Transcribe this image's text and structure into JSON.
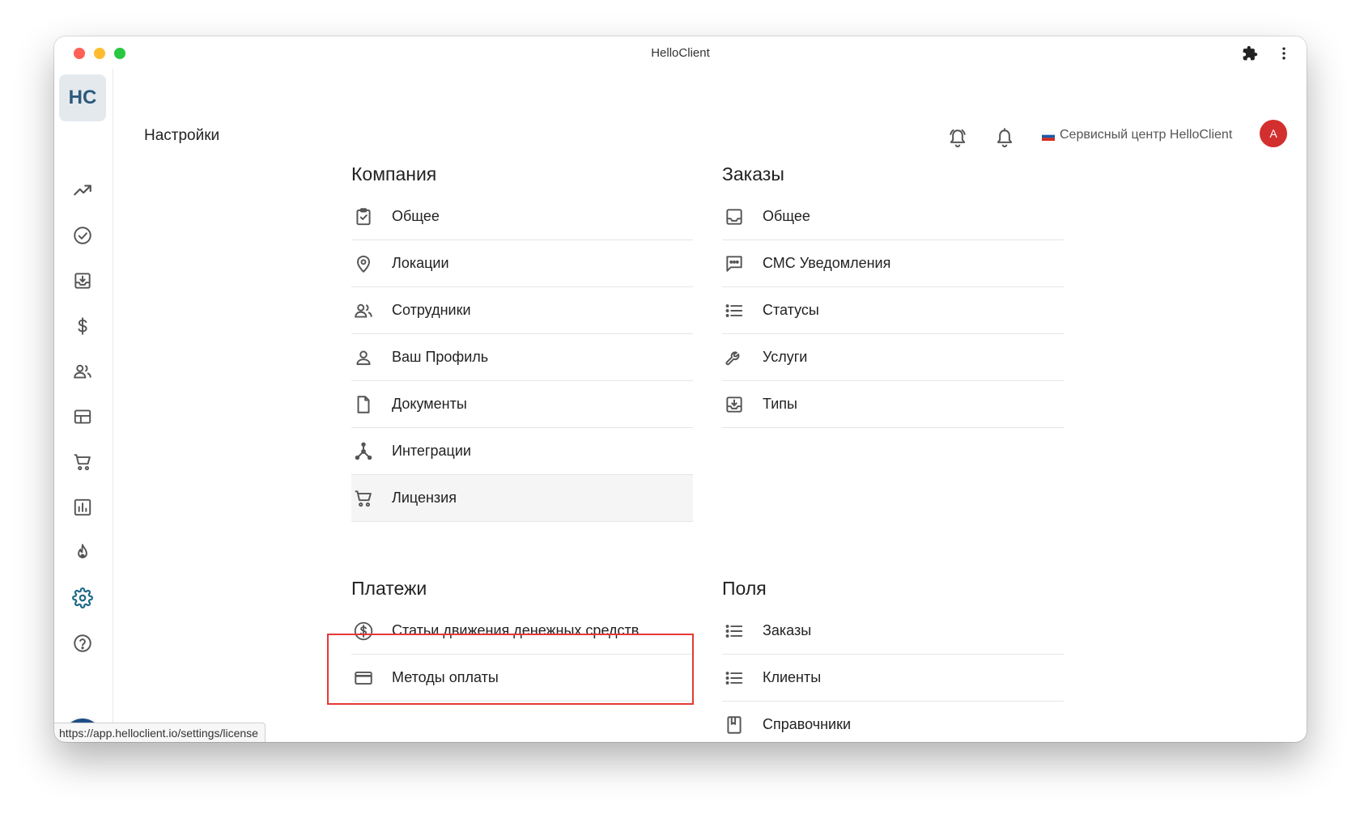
{
  "window": {
    "title": "HelloClient"
  },
  "sidebar": {
    "logo": "HC",
    "items": [
      {
        "name": "trending-up-icon"
      },
      {
        "name": "check-circle-icon"
      },
      {
        "name": "inbox-download-icon"
      },
      {
        "name": "dollar-icon"
      },
      {
        "name": "people-icon"
      },
      {
        "name": "table-icon"
      },
      {
        "name": "cart-icon"
      },
      {
        "name": "bar-chart-icon"
      },
      {
        "name": "fire-icon"
      },
      {
        "name": "settings-gear-icon",
        "active": true
      },
      {
        "name": "help-circle-icon"
      }
    ]
  },
  "header": {
    "title": "Настройки",
    "company": "Сервисный центр HelloClient",
    "avatar_initial": "A"
  },
  "sections": {
    "company": {
      "title": "Компания",
      "items": [
        {
          "label": "Общее",
          "icon": "clipboard-check-icon"
        },
        {
          "label": "Локации",
          "icon": "location-pin-icon"
        },
        {
          "label": "Сотрудники",
          "icon": "people-icon"
        },
        {
          "label": "Ваш Профиль",
          "icon": "person-icon"
        },
        {
          "label": "Документы",
          "icon": "document-icon"
        },
        {
          "label": "Интеграции",
          "icon": "hub-icon"
        },
        {
          "label": "Лицензия",
          "icon": "cart-icon",
          "active": true
        }
      ]
    },
    "orders": {
      "title": "Заказы",
      "items": [
        {
          "label": "Общее",
          "icon": "inbox-icon"
        },
        {
          "label": "СМС Уведомления",
          "icon": "sms-icon"
        },
        {
          "label": "Статусы",
          "icon": "list-icon"
        },
        {
          "label": "Услуги",
          "icon": "wrench-icon"
        },
        {
          "label": "Типы",
          "icon": "inbox-download-icon"
        }
      ]
    },
    "payments": {
      "title": "Платежи",
      "items": [
        {
          "label": "Статьи движения денежных средств",
          "icon": "dollar-circle-icon"
        },
        {
          "label": "Методы оплаты",
          "icon": "credit-card-icon"
        }
      ]
    },
    "fields": {
      "title": "Поля",
      "items": [
        {
          "label": "Заказы",
          "icon": "list-icon"
        },
        {
          "label": "Клиенты",
          "icon": "list-icon"
        },
        {
          "label": "Справочники",
          "icon": "book-icon"
        }
      ]
    }
  },
  "status_bar": {
    "url": "https://app.helloclient.io/settings/license"
  },
  "colors": {
    "accent": "#1e4d86",
    "active_nav": "#1e6a8a",
    "highlight": "#e53935",
    "avatar": "#d32f2f"
  }
}
